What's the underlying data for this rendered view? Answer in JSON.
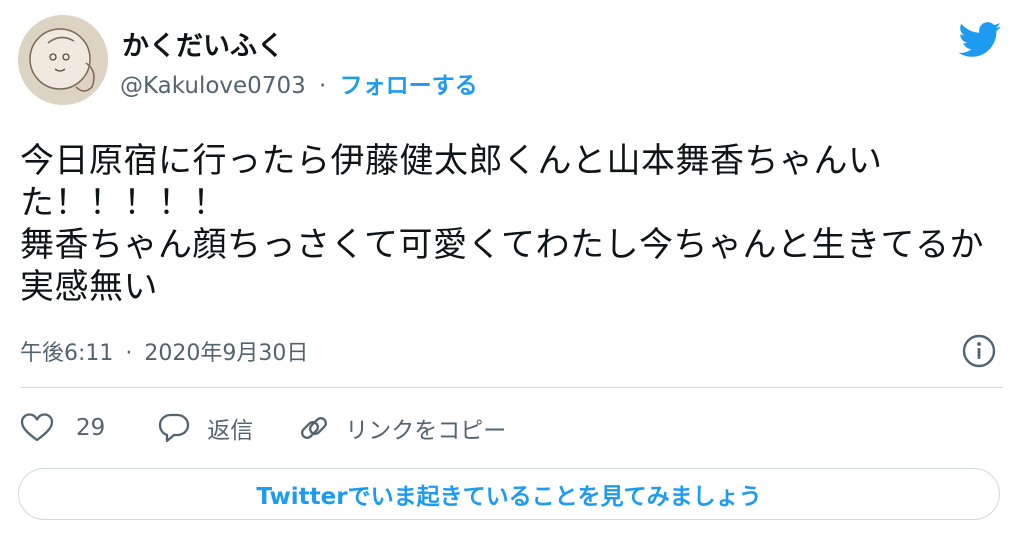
{
  "author": {
    "display_name": "かくだいふく",
    "handle": "@Kakulove0703",
    "separator": "·",
    "follow_label": "フォローする"
  },
  "tweet": {
    "text": "今日原宿に行ったら伊藤健太郎くんと山本舞香ちゃんいた！！！！！\n舞香ちゃん顔ちっさくて可愛くてわたし今ちゃんと生きてるか実感無い",
    "time": "午後6:11",
    "separator": "·",
    "date": "2020年9月30日"
  },
  "actions": {
    "like_count": "29",
    "reply_label": "返信",
    "copy_link_label": "リンクをコピー"
  },
  "cta_label": "Twitterでいま起きていることを見てみましょう",
  "colors": {
    "brand": "#1d9bf0",
    "text": "#0f1419",
    "secondary": "#536471",
    "border": "#cfd9de"
  },
  "icons": [
    "twitter-bird-icon",
    "info-icon",
    "heart-icon",
    "reply-bubble-icon",
    "link-icon"
  ]
}
